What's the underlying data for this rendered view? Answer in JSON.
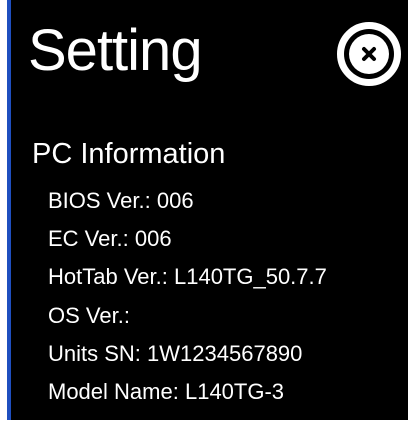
{
  "window": {
    "title": "Setting"
  },
  "close_button": {
    "icon": "close-icon"
  },
  "pc_info": {
    "heading": "PC Information",
    "items": [
      {
        "label": "BIOS Ver.:",
        "value": "006"
      },
      {
        "label": "EC Ver.:",
        "value": "006"
      },
      {
        "label": "HotTab Ver.:",
        "value": "L140TG_50.7.7"
      },
      {
        "label": "OS Ver.:",
        "value": ""
      },
      {
        "label": "Units SN:",
        "value": "1W1234567890"
      },
      {
        "label": "Model Name:",
        "value": "L140TG-3"
      }
    ]
  },
  "colors": {
    "background": "#000000",
    "text": "#ffffff",
    "accent_border": "#1f4fbf"
  }
}
